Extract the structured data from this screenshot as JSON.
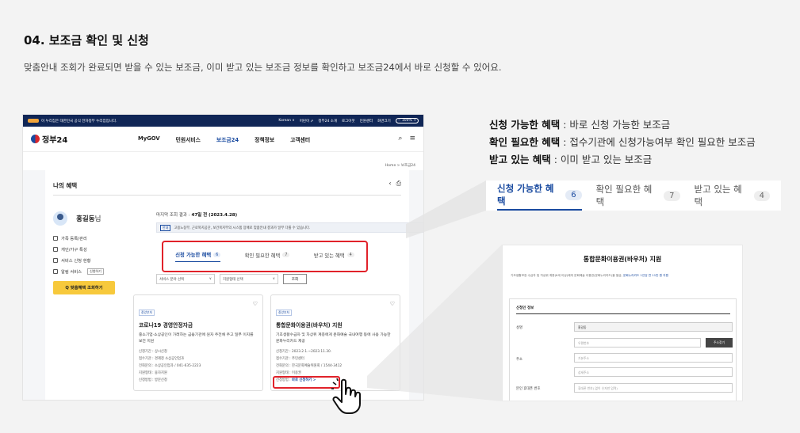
{
  "header": {
    "title": "04. 보조금 확인 및 신청",
    "description": "맞춤안내 조회가 완료되면 받을 수 있는 보조금, 이미 받고 있는 보조금 정보를 확인하고 보조금24에서 바로 신청할 수 있어요."
  },
  "browser": {
    "gov_notice": "이 누리집은 대한민국 공식 전자정부 누리집입니다.",
    "top_links": [
      "Korean ∨",
      "어린이 ⇗",
      "정부24 소개",
      "로그아웃",
      "민원센터",
      "화면크기"
    ],
    "zoom": "− 100% +",
    "logo": "정부24",
    "menu": [
      "MyGOV",
      "민원서비스",
      "보조금24",
      "정책정보",
      "고객센터"
    ],
    "breadcrumb": "Home  >  보조금24",
    "my_title": "나의 혜택",
    "user_name": "홍길동",
    "user_suffix": "님",
    "side_links": [
      {
        "label": "가족 등록/관리"
      },
      {
        "label": "개인/가구 특성"
      },
      {
        "label": "서비스 신청 현황"
      },
      {
        "label": "알림 서비스",
        "extra": "신청하기"
      }
    ],
    "match_button": "Q 맞춤혜택 조회하기",
    "last_check_label": "마지막 조회 결과 :",
    "last_check_value": "47일 전 (2023.4.28)",
    "notice_tag": "안내",
    "notice_text": "고용노동부, 근로복지공단, 보건복지부의 시스템 장애로 맞춤안내 결과가 일부 다를 수 있습니다.",
    "tabs": [
      {
        "label": "신청 가능한 혜택",
        "count": "6"
      },
      {
        "label": "확인 필요한 혜택",
        "count": "7"
      },
      {
        "label": "받고 있는 혜택",
        "count": "4"
      }
    ],
    "filter_1": "서비스 분야 선택",
    "filter_2": "지원형태 선택",
    "query_button": "조회",
    "cards": [
      {
        "org": "중앙부처",
        "title": "코로나19 경영안정자금",
        "desc": "중소기업·소상공인이 가래하는 금융기관에 원자 주전채 주고 일부 이지를 보전 지원",
        "items": [
          "신청기간 : 상시신청",
          "접수기관 : 경제청 소상공인업과",
          "전화문의 : 소상공인업과 / 041-635-2223",
          "지원형태 : 융자지원",
          "신청방법 : 방문신청"
        ]
      },
      {
        "org": "중앙부처",
        "title": "통합문화이용권(바우처) 지원",
        "desc": "기초생활수급자 및 차상위 계층에게 문화예술 국내여행 등에 사용 가능한 문화누리카드 제공",
        "items": [
          "신청기간 : 2023.2.1.~2023.11.30.",
          "접수기관 : 주민센터",
          "전화문의 : 한국문화예술위원회 / 1544-3412",
          "지원형태 : 이용권"
        ],
        "apply_label": "신청방법 :",
        "apply_value": "바로 신청하기 >"
      }
    ]
  },
  "legend": [
    {
      "bold": "신청 가능한 혜택",
      "text": " : 바로 신청 가능한 보조금"
    },
    {
      "bold": "확인 필요한 혜택",
      "text": " : 접수기관에 신청가능여부 확인 필요한 보조금"
    },
    {
      "bold": "받고 있는 혜택",
      "text": " : 이미 받고 있는 보조금"
    }
  ],
  "zoom_tabs": [
    {
      "label": "신청 가능한 혜택",
      "count": "6"
    },
    {
      "label": "확인 필요한 혜택",
      "count": "7"
    },
    {
      "label": "받고 있는 혜택",
      "count": "4"
    }
  ],
  "form": {
    "title": "통합문화이용권(바우처) 지원",
    "desc": "기초생활보장 수급자 및 차상위 계층(6세 이상)에게 문화예술 이용권(문화누리카드)을 발급,",
    "desc_link": "문화누리카드 1인당 연 11만 원 지원",
    "section": "신청인 정보",
    "name_label": "성명",
    "name_value": "홍길동",
    "zip_placeholder": "우편번호",
    "addr_button": "주소찾기",
    "addr_label": "주소",
    "addr_placeholder_1": "기본주소",
    "addr_placeholder_2": "상세주소",
    "phone_label": "본인 휴대폰 번호",
    "phone_placeholder": "휴대폰 번호(-없이 숫자만 입력)"
  },
  "colors": {
    "accent": "#1a4ba0",
    "highlight": "#e1222a",
    "match_button": "#f7c93c",
    "topbar": "#102656"
  }
}
